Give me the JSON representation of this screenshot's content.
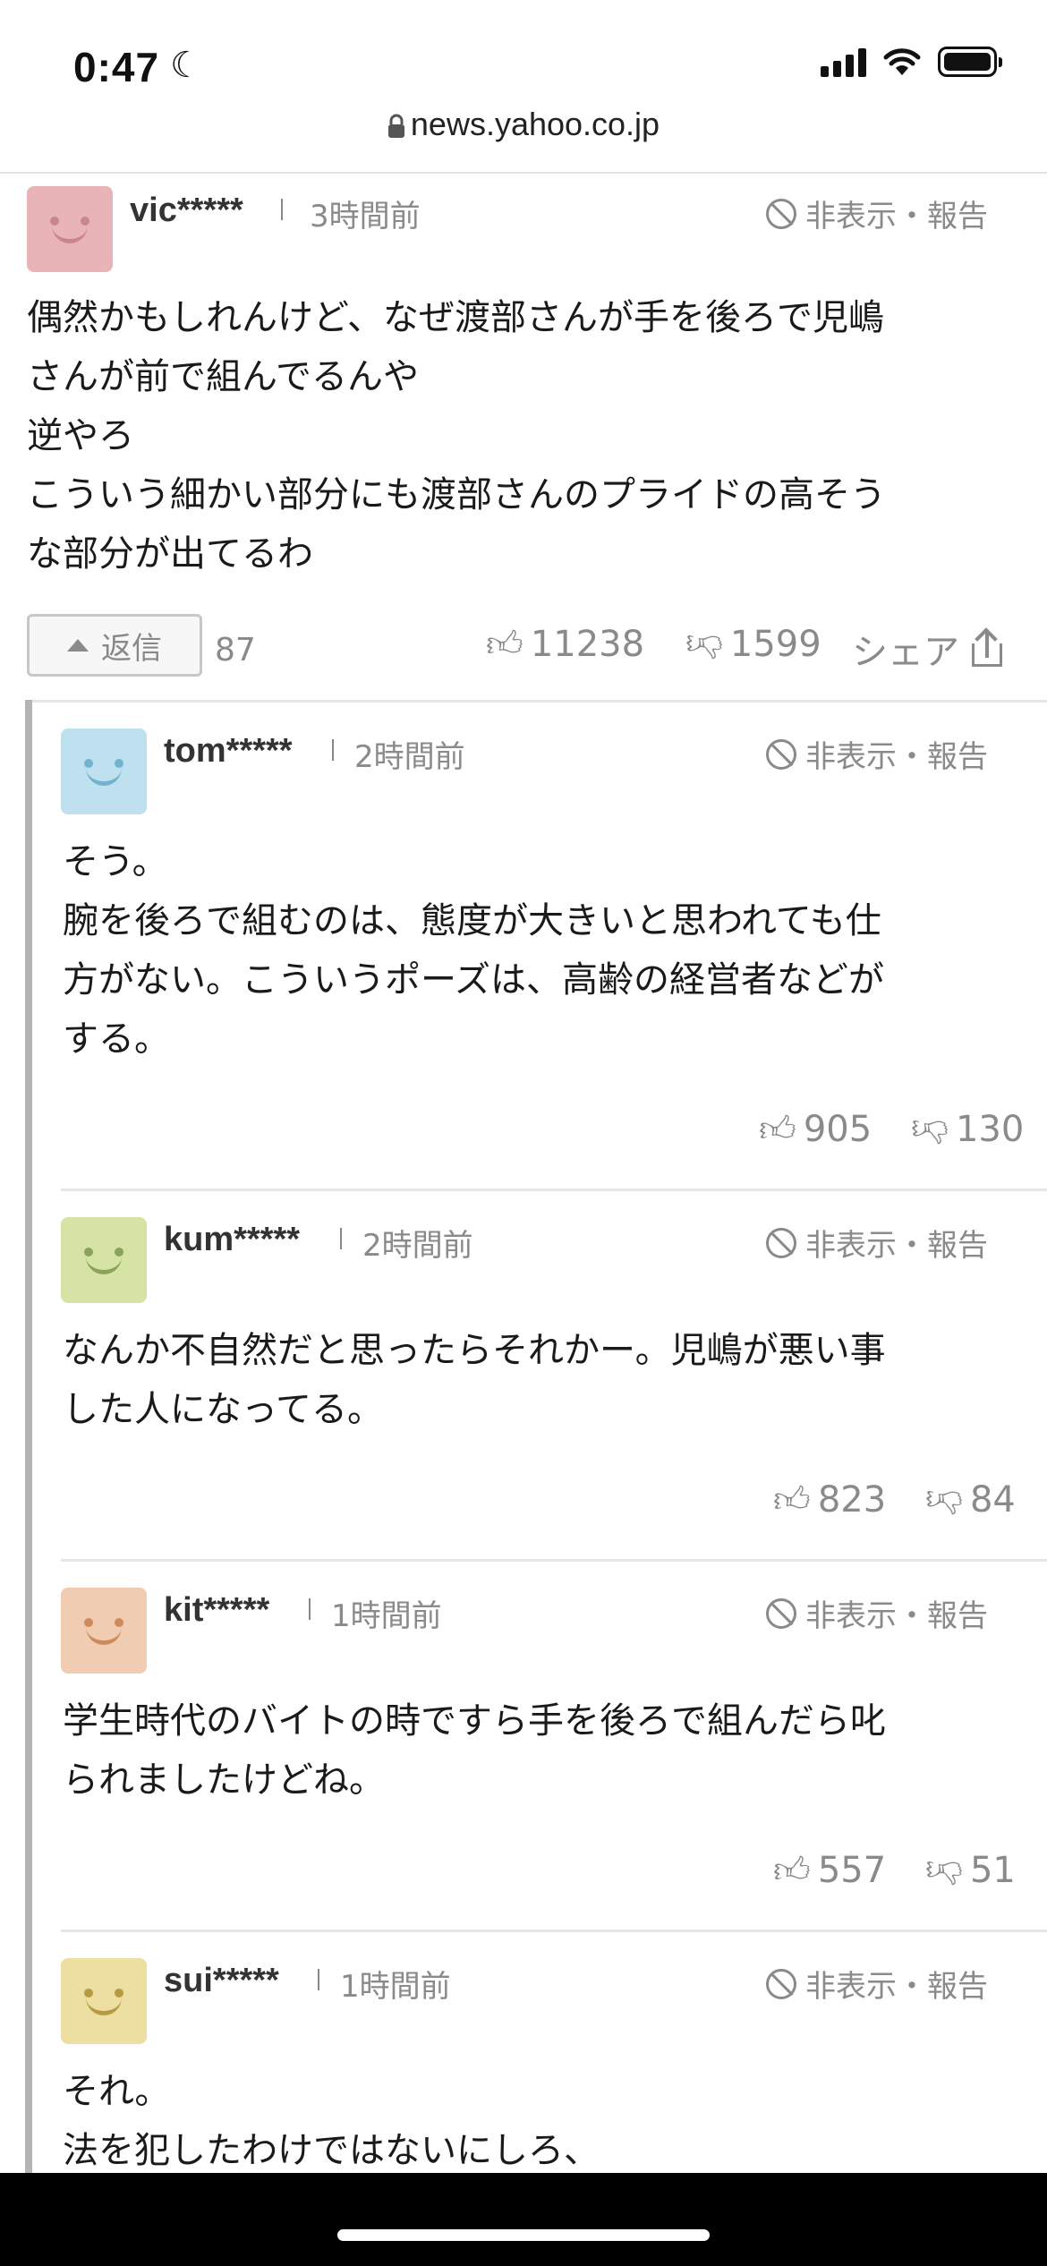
{
  "status_bar": {
    "time": "0:47",
    "url": "news.yahoo.co.jp"
  },
  "labels": {
    "hide_report": "非表示・報告",
    "reply": "返信",
    "share": "シェア"
  },
  "main_comment": {
    "username": "vic*****",
    "time": "3時間前",
    "text": "偶然かもしれんけど、なぜ渡部さんが手を後ろで児嶋\nさんが前で組んでるんや\n逆やろ\nこういう細かい部分にも渡部さんのプライドの高そう\nな部分が出てるわ",
    "reply_count": "87",
    "likes": "11238",
    "dislikes": "1599",
    "avatar_color": "#e8b4b8",
    "avatar_feature_color": "#c9878d"
  },
  "replies": [
    {
      "username": "tom*****",
      "time": "2時間前",
      "text": "そう。\n腕を後ろで組むのは、態度が大きいと思われても仕\n方がない。こういうポーズは、高齢の経営者などが\nする。",
      "likes": "905",
      "dislikes": "130",
      "avatar_color": "#bfe0ee",
      "avatar_feature_color": "#6fb3cf"
    },
    {
      "username": "kum*****",
      "time": "2時間前",
      "text": "なんか不自然だと思ったらそれかー。児嶋が悪い事\nした人になってる。",
      "likes": "823",
      "dislikes": "84",
      "avatar_color": "#d5e3a4",
      "avatar_feature_color": "#8aa35a"
    },
    {
      "username": "kit*****",
      "time": "1時間前",
      "text": "学生時代のバイトの時ですら手を後ろで組んだら叱\nられましたけどね。",
      "likes": "557",
      "dislikes": "51",
      "avatar_color": "#f0cdb2",
      "avatar_feature_color": "#cf8a5c"
    },
    {
      "username": "sui*****",
      "time": "1時間前",
      "text": "それ。\n法を犯したわけではないにしろ、",
      "avatar_color": "#ecdfa1",
      "avatar_feature_color": "#b59a3e"
    }
  ]
}
